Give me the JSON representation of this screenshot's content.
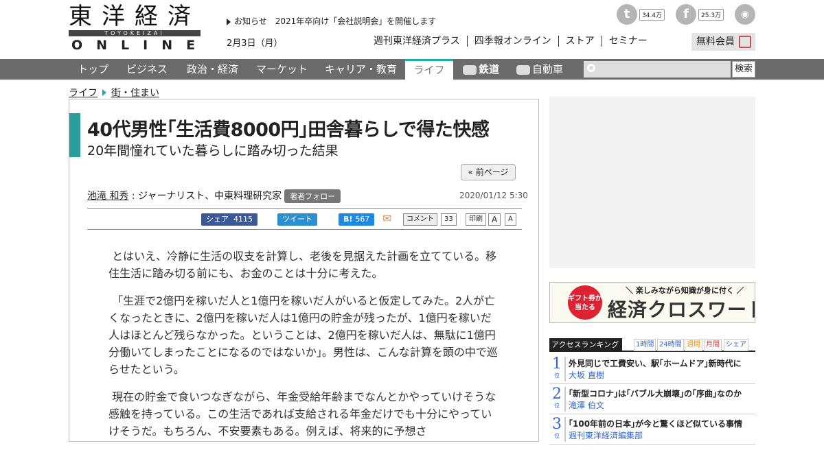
{
  "site": {
    "logo_kanji": "東洋経済",
    "logo_band": "TOYOKEIZAI",
    "logo_online": "ONLINE"
  },
  "header": {
    "notice": "お知らせ　2021年卒向け「会社説明会」を開催します",
    "date": "2月3日（月）",
    "links": [
      "週刊東洋経済プラス",
      "四季報オンライン",
      "ストア",
      "セミナー"
    ],
    "twitter_count": "34.4万",
    "facebook_count": "25.3万",
    "member_label": "無料会員"
  },
  "nav": {
    "items": [
      "トップ",
      "ビジネス",
      "政治・経済",
      "マーケット",
      "キャリア・教育",
      "ライフ",
      "鉄道",
      "自動車"
    ],
    "search_button": "検索"
  },
  "breadcrumb": [
    "ライフ",
    "街・住まい"
  ],
  "article": {
    "title": "40代男性｢生活費8000円｣田舎暮らしで得た快感",
    "subtitle": "20年間憧れていた暮らしに踏み切った結果",
    "prev_page": "« 前ページ",
    "author_name": "池滝 和秀",
    "author_role": " : ジャーナリスト、中東料理研究家",
    "follow_label": "著者フォロー",
    "published": "2020/01/12 5:30",
    "share": {
      "fb_label": "シェア",
      "fb_count": "4115",
      "tw_label": "ツイート",
      "hatena_label": "B!",
      "hatena_count": "567",
      "comment_label": "コメント",
      "comment_count": "33",
      "print_label": "印刷",
      "font_large": "A",
      "font_small": "A"
    },
    "paragraphs": [
      "とはいえ、冷静に生活の収支を計算し、老後を見据えた計画を立てている。移住生活に踏み切る前にも、お金のことは十分に考えた。",
      "「生涯で2億円を稼いだ人と1億円を稼いだ人がいると仮定してみた。2人が亡くなったときに、2億円を稼いだ人は1億円の貯金が残ったが、1億円を稼いだ人はほとんど残らなかった。ということは、2億円を稼いだ人は、無駄に1億円分働いてしまったことになるのではないか」。男性は、こんな計算を頭の中で巡らせたという。",
      "現在の貯金で食いつなぎながら、年金受給年齢までなんとかやっていけそうな感触を持っている。この生活であれば支給される年金だけでも十分にやっていけそうだ。もちろん、不安要素もある。例えば、将来的に予想さ"
    ]
  },
  "sidebar": {
    "banner_top": "＼ 楽しみながら知識が身に付く ／",
    "banner_circle": "ギフト券が当たる",
    "banner_big": "経済クロスワード",
    "ranking_label": "アクセスランキング",
    "ranking_tabs": [
      "1時間",
      "24時間",
      "週間",
      "月間",
      "シェア"
    ],
    "ranking": [
      {
        "num": "1",
        "unit": "位",
        "title": "外見同じで工費安い、駅｢ホームドア｣新時代に",
        "author": "大坂 直樹"
      },
      {
        "num": "2",
        "unit": "位",
        "title": "｢新型コロナ｣は｢バブル大崩壊｣の｢序曲｣なのか",
        "author": "滝澤 伯文"
      },
      {
        "num": "3",
        "unit": "位",
        "title": "｢100年前の日本｣が今と驚くほど似ている事情",
        "author": "週刊東洋経済編集部"
      }
    ]
  }
}
